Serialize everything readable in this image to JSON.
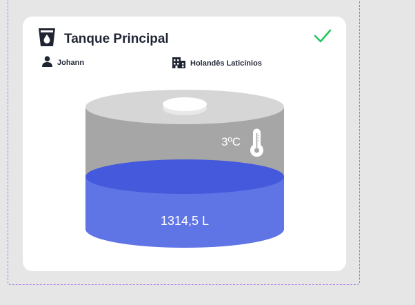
{
  "tank": {
    "name": "Tanque Principal",
    "operator": "Johann",
    "company": "Holandês Laticínios",
    "temperature": "3ºC",
    "volume": "1314,5 L",
    "status": "ok"
  },
  "icons": {
    "title": "water-cup-icon",
    "operator": "user-icon",
    "company": "building-icon",
    "status": "check-icon",
    "temperature": "thermometer-icon"
  },
  "colors": {
    "background": "#e6e6e6",
    "card": "#ffffff",
    "text": "#1f2533",
    "check": "#22c55e",
    "tank_body": "#a6a6a6",
    "tank_top": "#d6d6d6",
    "liquid_side": "#5f74e5",
    "liquid_top": "#4559dc",
    "frame_dash": "#a97ae8"
  }
}
